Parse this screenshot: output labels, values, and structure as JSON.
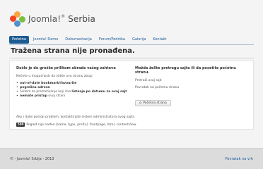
{
  "header": {
    "brand": "Joomla!",
    "brand_sup": "®",
    "site": "Serbia"
  },
  "nav": {
    "items": [
      {
        "label": "Početna"
      },
      {
        "label": "Joomla! Demo"
      },
      {
        "label": "Dokumentacija"
      },
      {
        "label": "Forum/Podrška"
      },
      {
        "label": "Galerija"
      },
      {
        "label": "Kontakt"
      }
    ]
  },
  "main": {
    "title": "Tražena strana nije pronađena.",
    "left": {
      "heading": "Došlo je do greške prilikom obrade vašeg zahteva",
      "intro": "Nećete u mogućnosti da vidite ovu stranu zbog:",
      "reasons": [
        {
          "bold": "out-of-date bookmark/favourite",
          "rest": ""
        },
        {
          "bold": "pogrešna adresa",
          "rest": ""
        },
        {
          "bold": "",
          "rest": "Sistem za pretraživanje koji ima ",
          "bold2": "listanje po datumu za ovaj sajt"
        },
        {
          "bold": "nemate pristup",
          "rest": " ovoj strani"
        }
      ]
    },
    "right": {
      "heading": "Možda želite pretragu sajta ili da posetite početnu stranu.",
      "search_label": "Pretraži ovaj sajt",
      "back_text": "Povratak na početnu stranu",
      "home_button": "Početna strana"
    },
    "bottom": {
      "contact_text": "Ako i dalje postoji problem, kontaktirajte sistem administratora ovog sajta",
      "error_code": "500",
      "error_message": "Pogled nije nađen [name, type, prefix]: frontpage, html, contentView"
    }
  },
  "footer": {
    "copyright": "© - Joomla! Srbija - 2013",
    "back_to_top": "Povratak na vrh"
  }
}
